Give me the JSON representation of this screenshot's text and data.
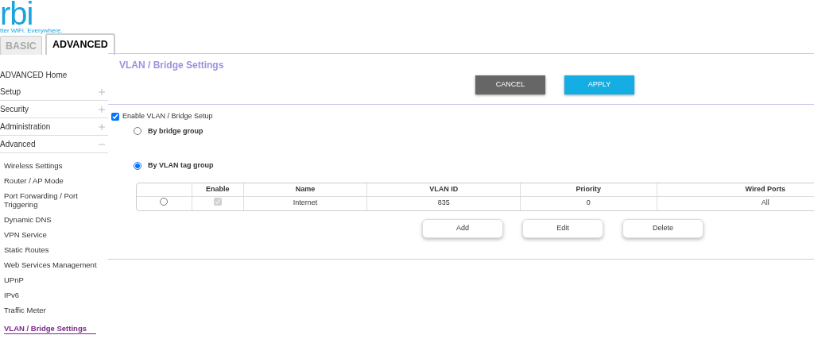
{
  "logo": {
    "text": "rbi",
    "tagline": "tter WiFi. Everywhere."
  },
  "mode_tabs": [
    {
      "label": "BASIC",
      "selected": false
    },
    {
      "label": "ADVANCED",
      "selected": true
    }
  ],
  "sidebar": {
    "items": [
      {
        "kind": "link",
        "label": "ADVANCED Home"
      },
      {
        "kind": "section",
        "label": "Setup",
        "expanded": false
      },
      {
        "kind": "section",
        "label": "Security",
        "expanded": false
      },
      {
        "kind": "section",
        "label": "Administration",
        "expanded": false
      },
      {
        "kind": "section",
        "label": "Advanced",
        "expanded": true,
        "children": [
          {
            "label": "Wireless Settings",
            "selected": false
          },
          {
            "label": "Router / AP Mode",
            "selected": false
          },
          {
            "label": "Port Forwarding / Port Triggering",
            "selected": false
          },
          {
            "label": "Dynamic DNS",
            "selected": false
          },
          {
            "label": "VPN Service",
            "selected": false
          },
          {
            "label": "Static Routes",
            "selected": false
          },
          {
            "label": "Web Services Management",
            "selected": false
          },
          {
            "label": "UPnP",
            "selected": false
          },
          {
            "label": "IPv6",
            "selected": false
          },
          {
            "label": "Traffic Meter",
            "selected": false
          },
          {
            "label": "VLAN / Bridge Settings",
            "selected": true
          }
        ]
      }
    ]
  },
  "page_title": "VLAN / Bridge Settings",
  "buttons": [
    {
      "kind": "cancel",
      "label": "CANCEL"
    },
    {
      "kind": "apply",
      "label": "APPLY"
    }
  ],
  "enable_setup": {
    "label": "Enable VLAN / Bridge Setup",
    "checked": true
  },
  "modes": [
    {
      "label": "By bridge group",
      "selected": false
    },
    {
      "label": "By VLAN tag group",
      "selected": true
    }
  ],
  "table": {
    "columns": [
      "",
      "Enable",
      "Name",
      "VLAN ID",
      "Priority",
      "Wired Ports"
    ],
    "rows": [
      {
        "selected": false,
        "enabled": true,
        "cells": [
          "",
          "",
          "Internet",
          "835",
          "0",
          "All"
        ]
      }
    ]
  },
  "table_actions": [
    "Add",
    "Edit",
    "Delete"
  ]
}
